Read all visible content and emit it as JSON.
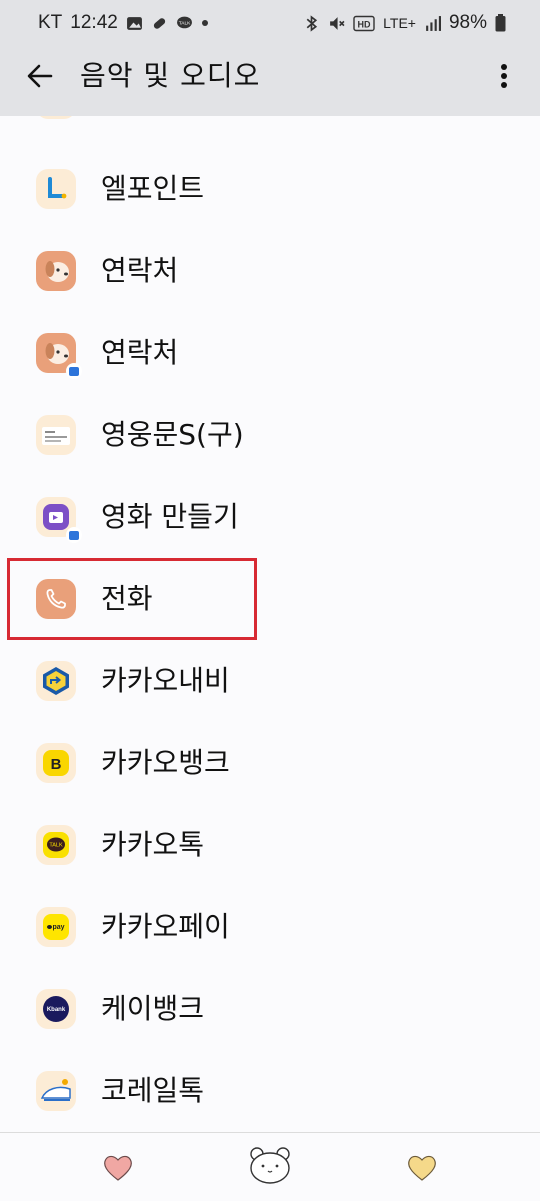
{
  "status_bar": {
    "carrier": "KT",
    "time": "12:42",
    "network": "LTE+",
    "battery": "98%"
  },
  "header": {
    "title": "음악 및 오디오"
  },
  "apps": [
    {
      "label": "엘포인트",
      "icon": "lpoint-icon"
    },
    {
      "label": "연락처",
      "icon": "contacts-icon"
    },
    {
      "label": "연락처",
      "icon": "contacts-work-icon"
    },
    {
      "label": "영웅문S(구)",
      "icon": "youngwoongmun-icon"
    },
    {
      "label": "영화 만들기",
      "icon": "movie-maker-work-icon"
    },
    {
      "label": "전화",
      "icon": "phone-icon",
      "highlighted": true
    },
    {
      "label": "카카오내비",
      "icon": "kakaonavi-icon"
    },
    {
      "label": "카카오뱅크",
      "icon": "kakaobank-icon"
    },
    {
      "label": "카카오톡",
      "icon": "kakaotalk-icon",
      "icon_text": "TALK"
    },
    {
      "label": "카카오페이",
      "icon": "kakaopay-icon",
      "icon_text": "pay"
    },
    {
      "label": "케이뱅크",
      "icon": "kbank-icon",
      "icon_text": "Kbank"
    },
    {
      "label": "코레일톡",
      "icon": "korailtalk-icon"
    }
  ],
  "colors": {
    "highlight": "#d72a33",
    "accent": "#e9a07a"
  },
  "bottom_bar": [
    "heart-pink-icon",
    "bear-face-icon",
    "heart-yellow-icon"
  ]
}
